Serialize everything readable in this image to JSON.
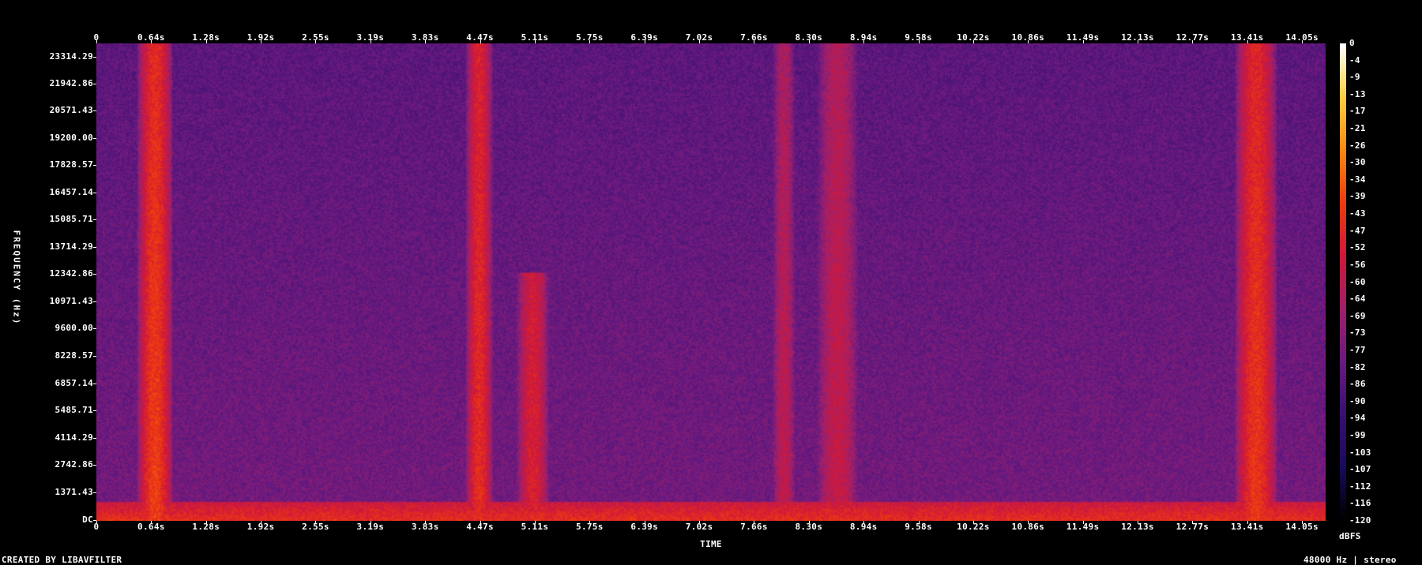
{
  "chart_data": {
    "type": "heatmap",
    "xlabel": "TIME",
    "ylabel": "FREQUENCY (Hz)",
    "x_ticks": [
      "0",
      "0.64s",
      "1.28s",
      "1.92s",
      "2.55s",
      "3.19s",
      "3.83s",
      "4.47s",
      "5.11s",
      "5.75s",
      "6.39s",
      "7.02s",
      "7.66s",
      "8.30s",
      "8.94s",
      "9.58s",
      "10.22s",
      "10.86s",
      "11.49s",
      "12.13s",
      "12.77s",
      "13.41s",
      "14.05s"
    ],
    "y_ticks": [
      "23314.29",
      "21942.86",
      "20571.43",
      "19200.00",
      "17828.57",
      "16457.14",
      "15085.71",
      "13714.29",
      "12342.86",
      "10971.43",
      "9600.00",
      "8228.57",
      "6857.14",
      "5485.71",
      "4114.29",
      "2742.86",
      "1371.43",
      "DC"
    ],
    "colorbar_ticks": [
      "0",
      "-4",
      "-9",
      "-13",
      "-17",
      "-21",
      "-26",
      "-30",
      "-34",
      "-39",
      "-43",
      "-47",
      "-52",
      "-56",
      "-60",
      "-64",
      "-69",
      "-73",
      "-77",
      "-82",
      "-86",
      "-90",
      "-94",
      "-99",
      "-103",
      "-107",
      "-112",
      "-116",
      "-120"
    ],
    "colorbar_unit": "dBFS",
    "xlim": [
      0,
      14.3
    ],
    "ylim": [
      0,
      24000
    ],
    "clim": [
      -120,
      0
    ],
    "colormap": [
      "#000000",
      "#1a0a5c",
      "#3a1070",
      "#6a1a80",
      "#a0206a",
      "#d0183a",
      "#ee3a10",
      "#f88a10",
      "#fcd040",
      "#ffffff"
    ],
    "loud_bands": [
      {
        "t_start": 0.55,
        "t_end": 0.8,
        "f_max": 24000,
        "level": -40
      },
      {
        "t_start": 4.35,
        "t_end": 4.55,
        "f_max": 24000,
        "level": -45
      },
      {
        "t_start": 4.95,
        "t_end": 5.2,
        "f_max": 12500,
        "level": -50
      },
      {
        "t_start": 13.35,
        "t_end": 13.65,
        "f_max": 24000,
        "level": -42
      },
      {
        "t_start": 7.9,
        "t_end": 8.1,
        "f_max": 24000,
        "level": -58
      },
      {
        "t_start": 8.45,
        "t_end": 8.8,
        "f_max": 24000,
        "level": -56
      }
    ],
    "low_freq_floor_level": -45
  },
  "footer": {
    "created_by": "CREATED BY LIBAVFILTER",
    "format": "48000 Hz | stereo"
  }
}
